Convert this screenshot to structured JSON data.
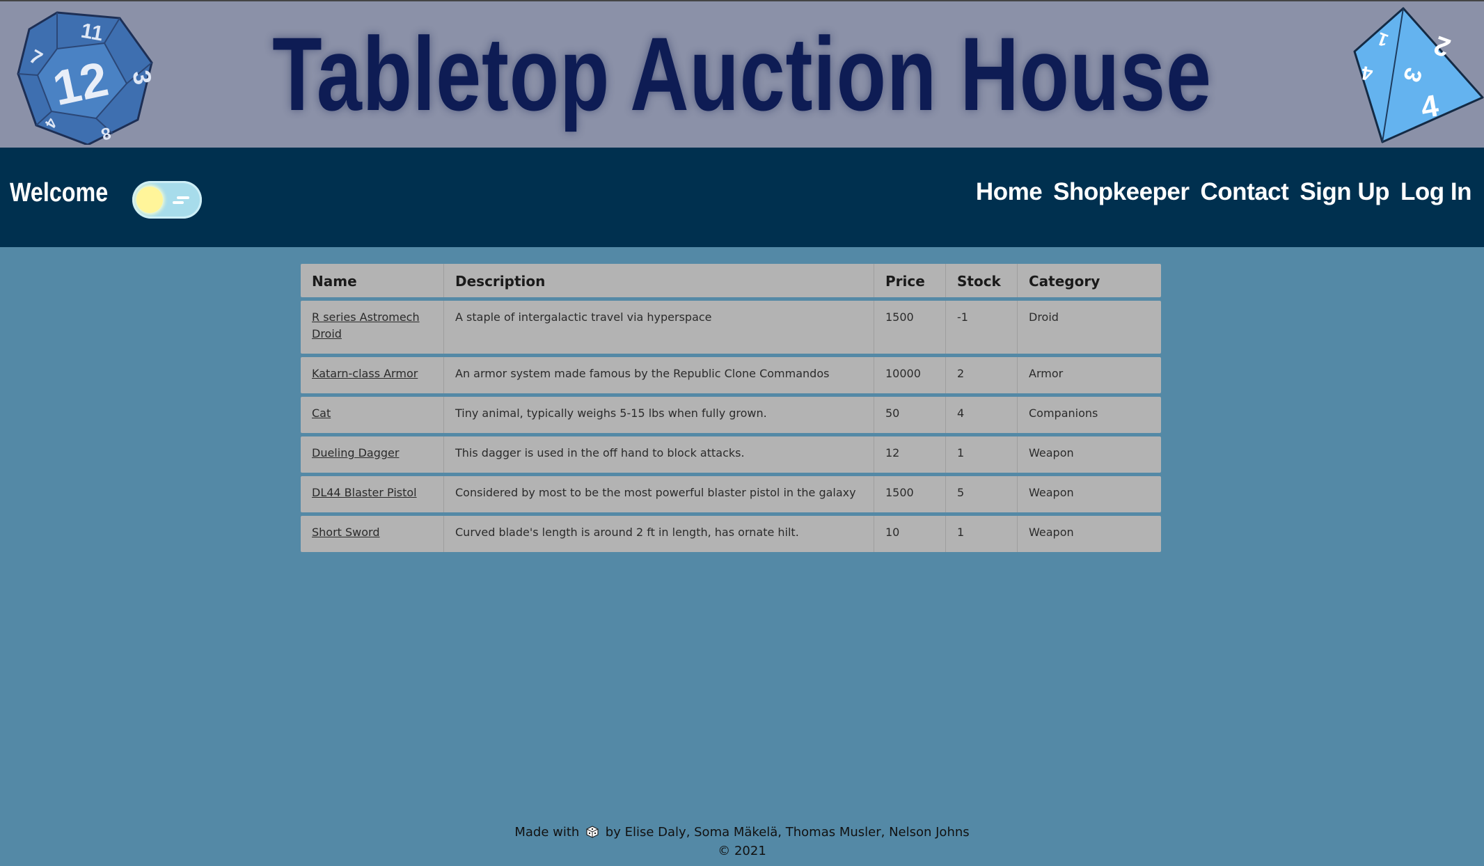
{
  "banner": {
    "title": "Tabletop Auction House",
    "d12_face_numbers": [
      "12",
      "11",
      "7",
      "3",
      "8",
      "4"
    ],
    "d4_face_numbers": [
      "2",
      "4",
      "3",
      "1",
      "4"
    ]
  },
  "nav": {
    "welcome": "Welcome",
    "links": [
      "Home",
      "Shopkeeper",
      "Contact",
      "Sign Up",
      "Log In"
    ]
  },
  "table": {
    "headers": [
      "Name",
      "Description",
      "Price",
      "Stock",
      "Category"
    ],
    "rows": [
      {
        "name": "R series Astromech Droid",
        "description": "A staple of intergalactic travel via hyperspace",
        "price": "1500",
        "stock": "-1",
        "category": "Droid"
      },
      {
        "name": "Katarn-class Armor",
        "description": "An armor system made famous by the Republic Clone Commandos",
        "price": "10000",
        "stock": "2",
        "category": "Armor"
      },
      {
        "name": "Cat",
        "description": "Tiny animal, typically weighs 5-15 lbs when fully grown.",
        "price": "50",
        "stock": "4",
        "category": "Companions"
      },
      {
        "name": "Dueling Dagger",
        "description": "This dagger is used in the off hand to block attacks.",
        "price": "12",
        "stock": "1",
        "category": "Weapon"
      },
      {
        "name": "DL44 Blaster Pistol",
        "description": "Considered by most to be the most powerful blaster pistol in the galaxy",
        "price": "1500",
        "stock": "5",
        "category": "Weapon"
      },
      {
        "name": "Short Sword",
        "description": "Curved blade's length is around 2 ft in length, has ornate hilt.",
        "price": "10",
        "stock": "1",
        "category": "Weapon"
      }
    ]
  },
  "footer": {
    "made_with": "Made with",
    "by": "by Elise Daly, Soma Mäkelä, Thomas Musler, Nelson Johns",
    "copyright": "© 2021"
  },
  "colors": {
    "banner_bg": "#8b91a8",
    "title": "#0e1c54",
    "nav_bg": "#00304f",
    "page_bg": "#5489a6",
    "table_cell": "#b3b3b3"
  },
  "icons": {
    "left_die": "d12-icon",
    "right_die": "d4-icon",
    "theme_toggle": "sun-toggle-icon",
    "footer_die": "die-icon"
  }
}
